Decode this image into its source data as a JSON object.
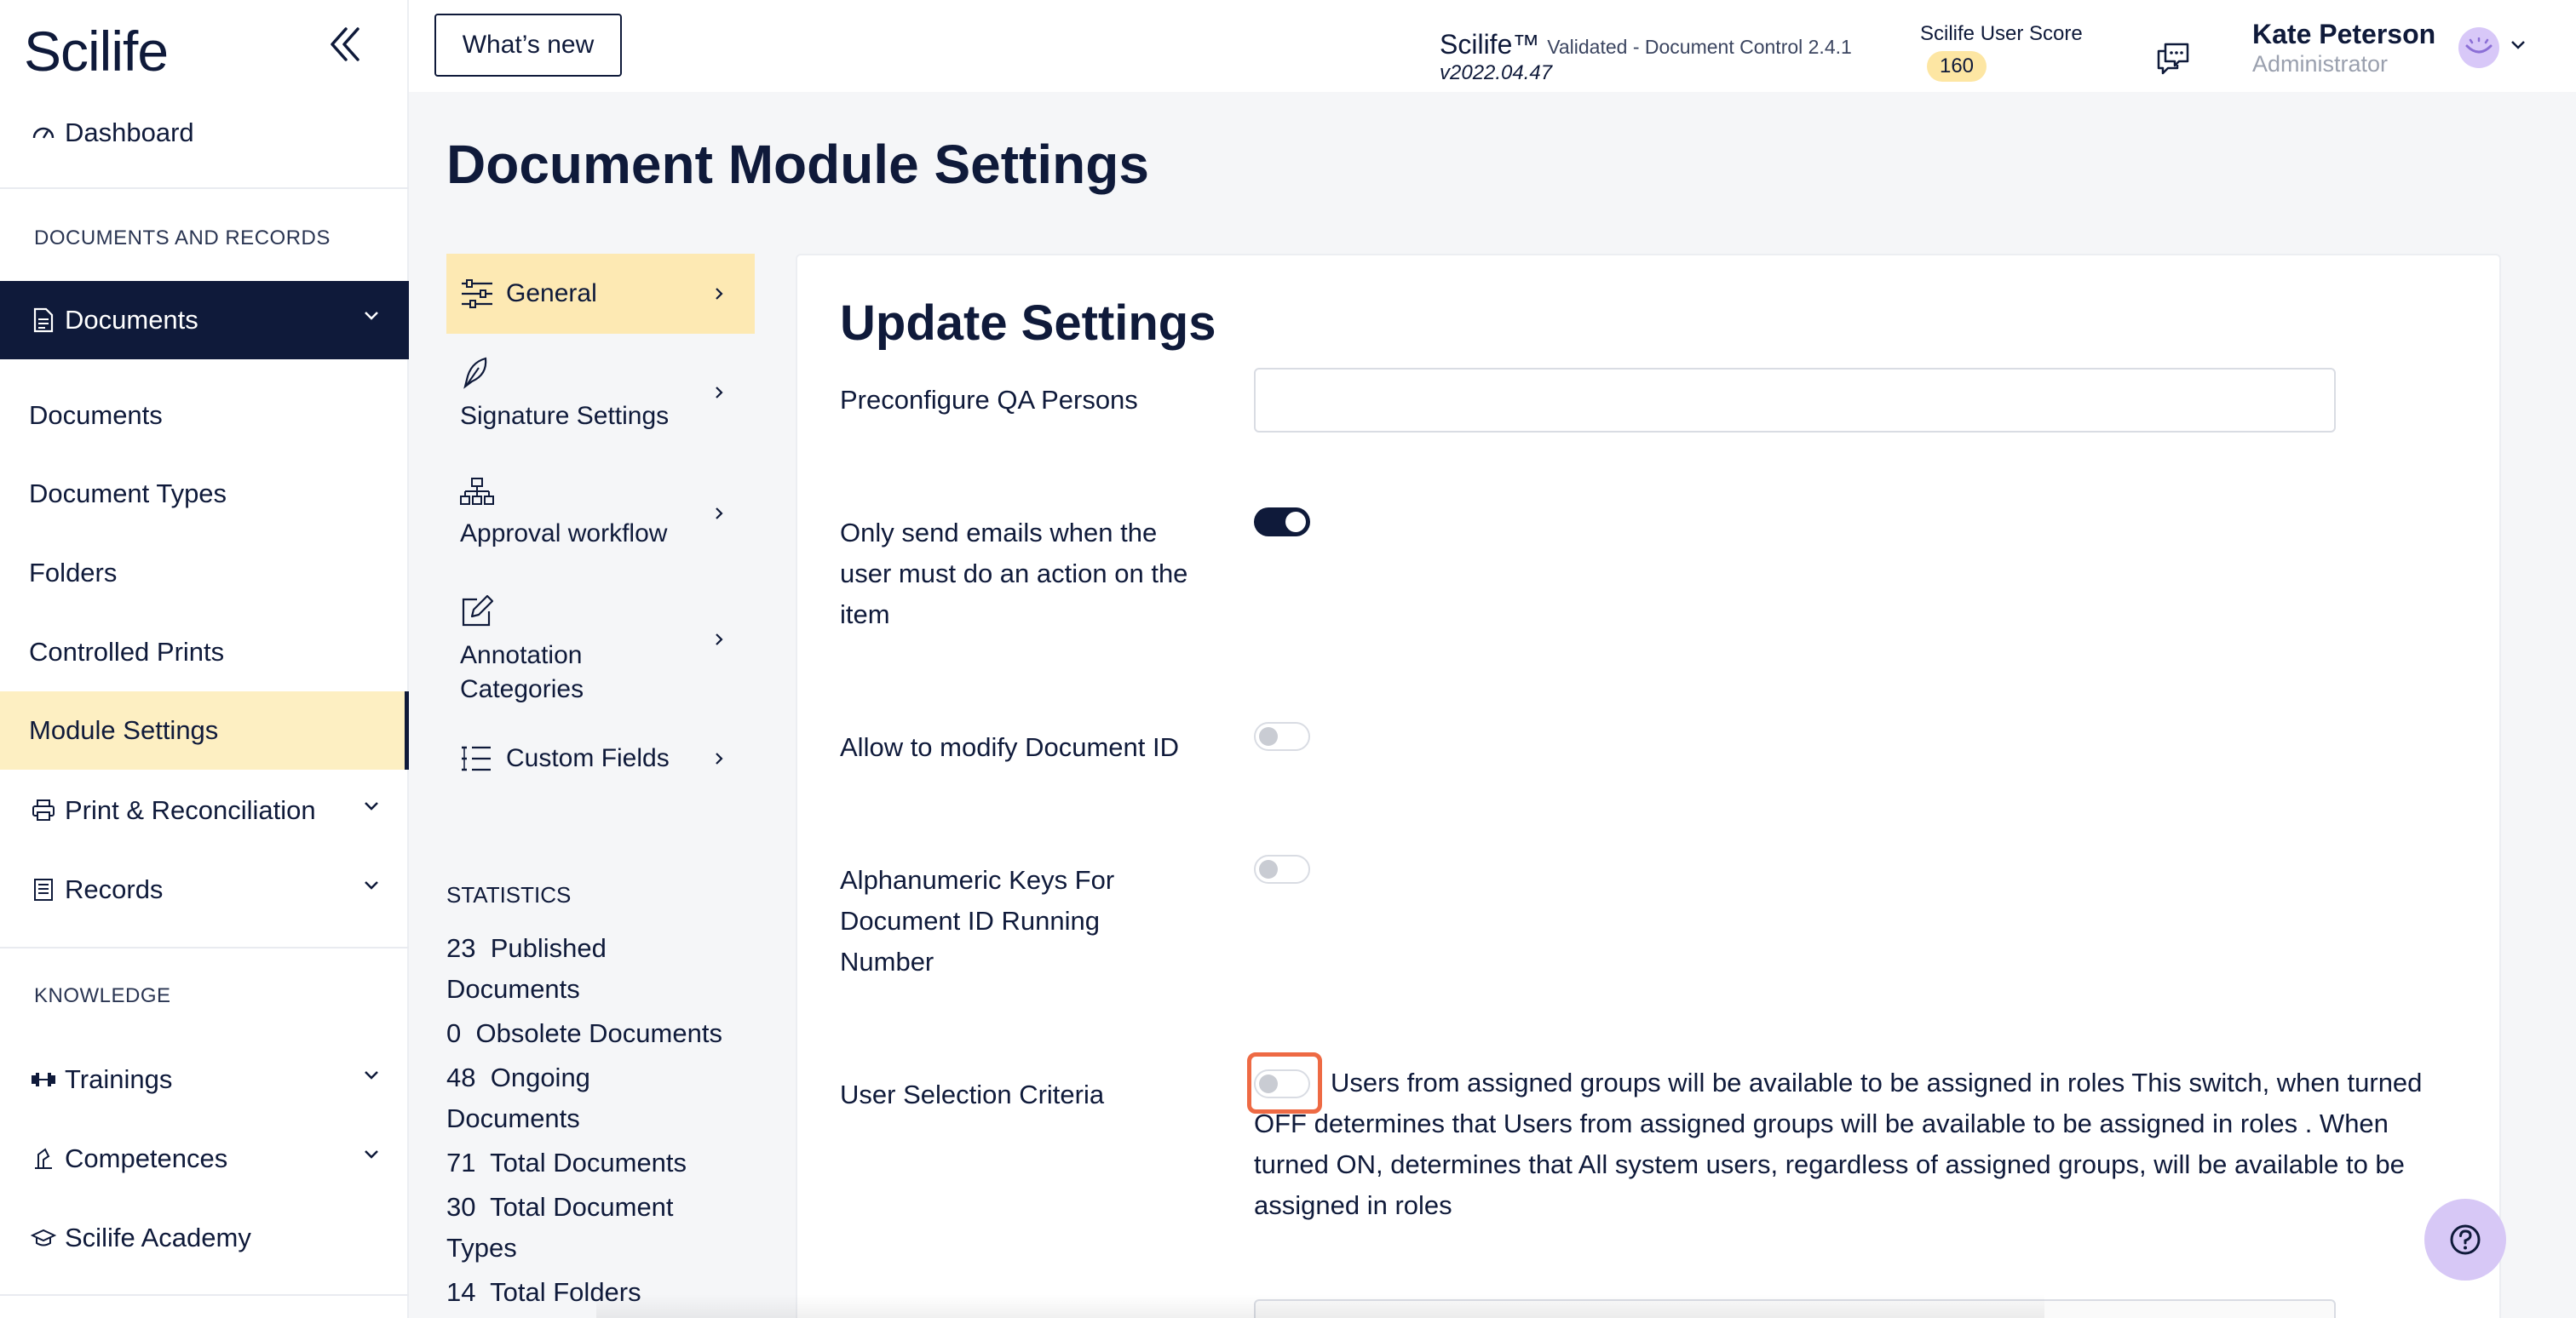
{
  "sidebar": {
    "logo": "Scilife",
    "dashboard": "Dashboard",
    "section_docs": "DOCUMENTS AND RECORDS",
    "documents_group": "Documents",
    "items": [
      "Documents",
      "Document Types",
      "Folders",
      "Controlled Prints",
      "Module Settings"
    ],
    "print_reconciliation": "Print & Reconciliation",
    "records": "Records",
    "section_knowledge": "KNOWLEDGE",
    "trainings": "Trainings",
    "competences": "Competences",
    "academy": "Scilife Academy"
  },
  "topbar": {
    "whats_new": "What’s new",
    "product_name": "Scilife™",
    "product_desc": "Validated - Document Control 2.4.1",
    "version": "v2022.04.47",
    "score_label": "Scilife User Score",
    "score_value": "160",
    "user_name": "Kate Peterson",
    "user_role": "Administrator"
  },
  "page": {
    "title": "Document Module Settings"
  },
  "settings_nav": {
    "general": "General",
    "signature": "Signature Settings",
    "approval": "Approval workflow",
    "annotation": "Annotation Categories",
    "custom_fields": "Custom Fields"
  },
  "statistics": {
    "title": "STATISTICS",
    "items": [
      {
        "count": "23",
        "label": "Published Documents"
      },
      {
        "count": "0",
        "label": "Obsolete Documents"
      },
      {
        "count": "48",
        "label": "Ongoing Documents"
      },
      {
        "count": "71",
        "label": "Total Documents"
      },
      {
        "count": "30",
        "label": "Total Document Types"
      },
      {
        "count": "14",
        "label": "Total Folders"
      }
    ]
  },
  "form": {
    "title": "Update Settings",
    "qa_label": "Preconfigure QA Persons",
    "qa_value": "",
    "emails_label": "Only send emails when the user must do an action on the item",
    "emails_on": true,
    "modify_id_label": "Allow to modify Document ID",
    "modify_id_on": false,
    "alnum_label": "Alphanumeric Keys For Document ID Running Number",
    "alnum_on": false,
    "criteria_label": "User Selection Criteria",
    "criteria_on": false,
    "criteria_text": "Users from assigned groups will be available to be assigned in roles This switch, when turned OFF determines that Users from assigned groups will be available to be assigned in roles . When turned ON, determines that All system users, regardless of assigned groups, will be available to be assigned in roles"
  },
  "colors": {
    "navy": "#0f1a3a",
    "highlight_yellow": "#fde9b3",
    "focus_orange": "#ee6a44",
    "accent_purple": "#d7c8f6"
  },
  "icons": [
    "dashboard-gauge-icon",
    "document-icon",
    "printer-icon",
    "records-icon",
    "dumbbell-icon",
    "competence-icon",
    "academy-cap-icon",
    "sliders-icon",
    "pen-nib-icon",
    "workflow-icon",
    "edit-icon",
    "list-icon",
    "chat-icon",
    "help-icon",
    "double-chevron-left-icon",
    "chevron-down-icon",
    "chevron-right-icon"
  ]
}
